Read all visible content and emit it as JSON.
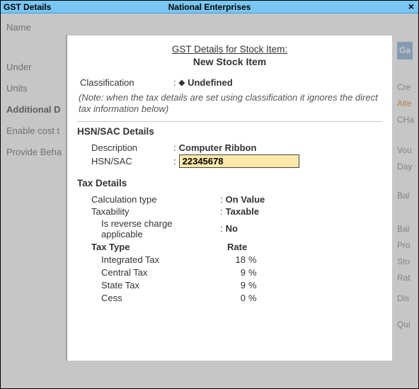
{
  "titlebar": {
    "left": "GST Details",
    "center": "National Enterprises",
    "close": "×"
  },
  "background": {
    "labels": {
      "name": "Name",
      "under": "Under",
      "units": "Units",
      "additional": "Additional D",
      "enable_cost": "Enable cost t",
      "provide_beh": "Provide Beha"
    },
    "right": {
      "ga": "Ga",
      "cre": "Cre",
      "alte": "Alte",
      "cha": "CHa",
      "vou": "Vou",
      "day": "Day",
      "bal1": "Bal",
      "bal2": "Bal",
      "pro": "Pro",
      "sto": "Sto",
      "rat": "Rat",
      "dis": "Dis",
      "qui": "Qui"
    }
  },
  "panel": {
    "title1": "GST Details for Stock Item:",
    "title2": "New Stock Item",
    "classification_label": "Classification",
    "classification_value": "Undefined",
    "note": "(Note: when the tax details are set using classification it ignores the direct tax information below)",
    "hsn_section": "HSN/SAC Details",
    "description_label": "Description",
    "description_value": "Computer Ribbon",
    "hsnsac_label": "HSN/SAC",
    "hsnsac_value": "22345678",
    "tax_section": "Tax Details",
    "calc_type_label": "Calculation type",
    "calc_type_value": "On Value",
    "taxability_label": "Taxability",
    "taxability_value": "Taxable",
    "reverse_label": "Is reverse charge applicable",
    "reverse_value": "No",
    "tax_type_hdr": "Tax Type",
    "rate_hdr": "Rate",
    "taxes": {
      "integrated": {
        "name": "Integrated Tax",
        "rate": "18",
        "pct": "%"
      },
      "central": {
        "name": "Central Tax",
        "rate": "9",
        "pct": "%"
      },
      "state": {
        "name": "State Tax",
        "rate": "9",
        "pct": "%"
      },
      "cess": {
        "name": "Cess",
        "rate": "0",
        "pct": "%"
      }
    }
  }
}
